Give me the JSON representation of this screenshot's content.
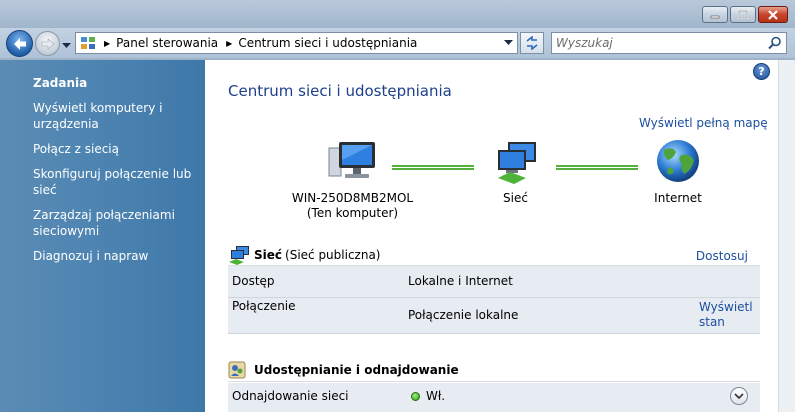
{
  "address_bar": {
    "crumbs": [
      "Panel sterowania",
      "Centrum sieci i udostępniania"
    ]
  },
  "search": {
    "placeholder": "Wyszukaj"
  },
  "sidebar": {
    "title": "Zadania",
    "items": [
      {
        "label": "Wyświetl komputery i urządzenia"
      },
      {
        "label": "Połącz z siecią"
      },
      {
        "label": "Skonfiguruj połączenie lub sieć"
      },
      {
        "label": "Zarządzaj połączeniami sieciowymi"
      },
      {
        "label": "Diagnozuj i napraw"
      }
    ]
  },
  "main": {
    "title": "Centrum sieci i udostępniania",
    "full_map_link": "Wyświetl pełną mapę",
    "help_label": "?",
    "map": {
      "computer_name": "WIN-250D8MB2MOL",
      "computer_sub": "(Ten komputer)",
      "network_label": "Sieć",
      "internet_label": "Internet"
    },
    "network": {
      "name": "Sieć",
      "type": "(Sieć publiczna)",
      "customize_link": "Dostosuj",
      "access_label": "Dostęp",
      "access_value": "Lokalne i Internet",
      "connection_label": "Połączenie",
      "connection_value": "Połączenie lokalne",
      "view_status_link_1": "Wyświetl",
      "view_status_link_2": "stan"
    },
    "sharing": {
      "title": "Udostępnianie i odnajdowanie",
      "discovery_label": "Odnajdowanie sieci",
      "discovery_value": "Wł."
    }
  },
  "colors": {
    "sidebar": "#4f85b2",
    "link": "#1c4fa0",
    "title": "#1e3f8a",
    "connection_line": "#56b03a"
  }
}
